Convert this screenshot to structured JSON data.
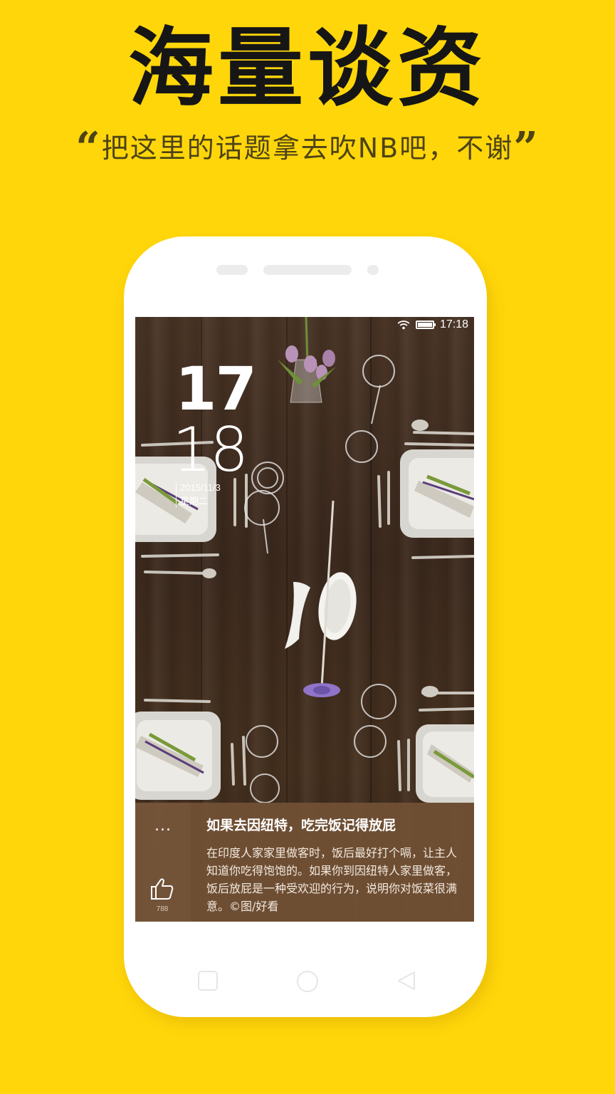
{
  "promo": {
    "headline": "海量谈资",
    "open_quote": "“",
    "tagline": "把这里的话题拿去吹NB吧，不谢",
    "close_quote": "”"
  },
  "status_bar": {
    "time": "17:18",
    "icons": [
      "wifi-icon",
      "battery-icon"
    ],
    "battery_level": 0.9
  },
  "lockscreen_clock": {
    "hour": "17",
    "minute": "18",
    "date": "2015/11/3",
    "weekday": "星期二"
  },
  "article_card": {
    "more_label": "...",
    "title": "如果去因纽特，吃完饭记得放屁",
    "body": "在印度人家家里做客时，饭后最好打个嗝，让主人知道你吃得饱饱的。如果你到因纽特人家里做客，饭后放屁是一种受欢迎的行为，说明你对饭菜很满意。©图/好看",
    "like_icon": "thumbs-up-icon",
    "like_count": "788"
  },
  "nav_keys": [
    "recent-apps-icon",
    "home-icon",
    "back-icon"
  ],
  "colors": {
    "background": "#ffd60a",
    "headline": "#161616",
    "panel": "#705034"
  }
}
